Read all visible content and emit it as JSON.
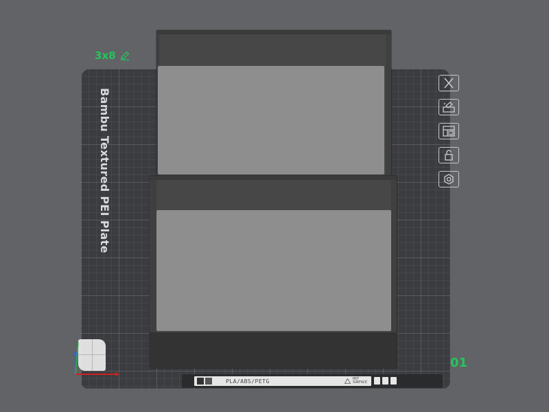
{
  "plate": {
    "name": "3x8",
    "title": "Bambu Textured PEI Plate",
    "number": "01",
    "label_strip": {
      "materials": "PLA/ABS/PETG",
      "warning_line1": "HOT",
      "warning_line2": "SURFACE"
    }
  },
  "toolbar": {
    "items": [
      {
        "name": "delete-plate",
        "icon": "close-icon"
      },
      {
        "name": "auto-orient",
        "icon": "orient-icon"
      },
      {
        "name": "arrange",
        "icon": "arrange-icon"
      },
      {
        "name": "lock-plate",
        "icon": "unlock-icon"
      },
      {
        "name": "plate-settings",
        "icon": "gear-icon"
      }
    ]
  },
  "colors": {
    "background": "#626366",
    "plate": "#3b3c3f",
    "accent_green": "#22c55e",
    "model": "#8e8e8e"
  }
}
